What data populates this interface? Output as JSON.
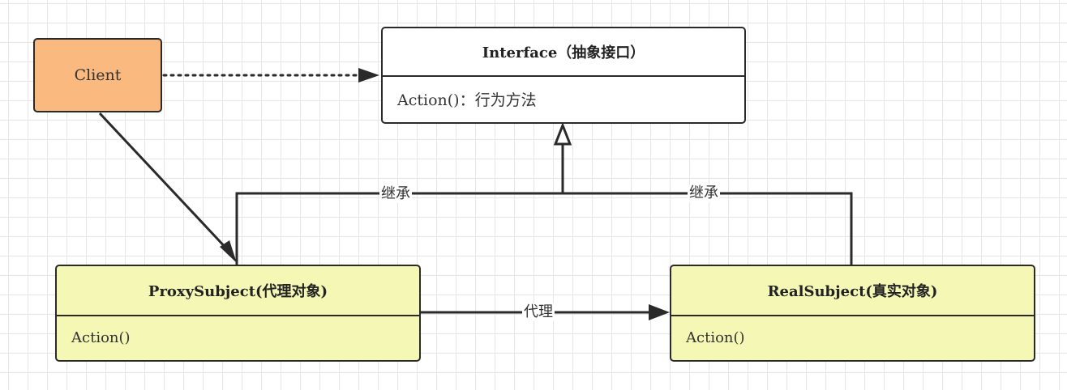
{
  "nodes": {
    "client": {
      "label": "Client"
    },
    "interface": {
      "title": "Interface（抽象接口）",
      "method": "Action()：行为方法"
    },
    "proxy": {
      "title": "ProxySubject(代理对象)",
      "method": "Action()"
    },
    "real": {
      "title": "RealSubject(真实对象)",
      "method": "Action()"
    }
  },
  "edges": {
    "proxy_inherit_label": "继承",
    "real_inherit_label": "继承",
    "delegate_label": "代理"
  },
  "colors": {
    "client_fill": "#f9b97f",
    "class_fill": "#f5f7b5",
    "line": "#2a2a2a"
  }
}
